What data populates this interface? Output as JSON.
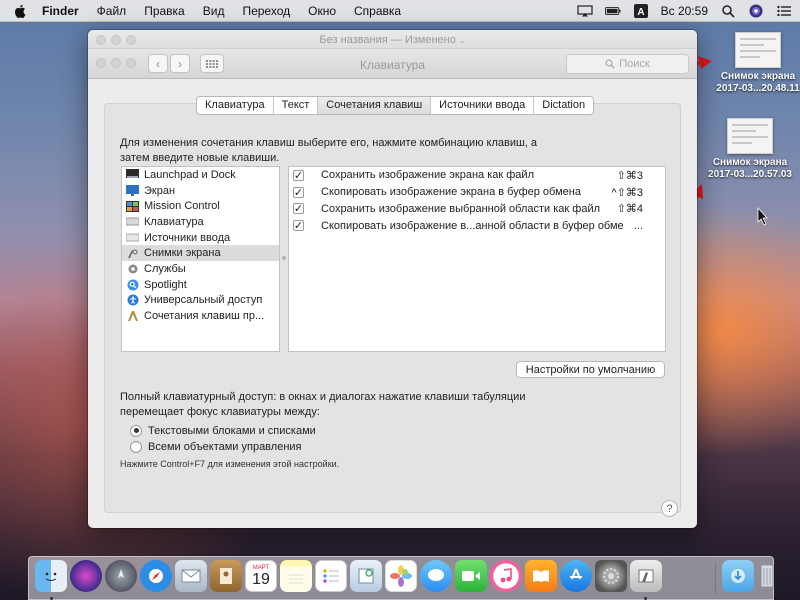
{
  "menubar": {
    "items": [
      {
        "label": "Finder",
        "bold": true
      },
      {
        "label": "Файл"
      },
      {
        "label": "Правка"
      },
      {
        "label": "Вид"
      },
      {
        "label": "Переход"
      },
      {
        "label": "Окно"
      },
      {
        "label": "Справка"
      }
    ],
    "input_source": "A",
    "clock": "Вс 20:59",
    "status_icons": [
      "airplay-icon",
      "battery-icon",
      "input-source-icon",
      "search-icon",
      "siri-icon",
      "notification-center-icon"
    ]
  },
  "window": {
    "document_title": "Без названия — Изменено",
    "pane_title": "Клавиатура",
    "search_placeholder": "Поиск",
    "tabs": [
      {
        "label": "Клавиатура",
        "active": false
      },
      {
        "label": "Текст",
        "active": false
      },
      {
        "label": "Сочетания клавиш",
        "active": true
      },
      {
        "label": "Источники ввода",
        "active": false
      },
      {
        "label": "Dictation",
        "active": false
      }
    ],
    "description": "Для изменения сочетания клавиш выберите его, нажмите комбинацию клавиш, а затем введите новые клавиши.",
    "categories": [
      {
        "label": "Launchpad и Dock",
        "icon": "launchpad-dock-icon",
        "selected": false
      },
      {
        "label": "Экран",
        "icon": "display-icon",
        "selected": false
      },
      {
        "label": "Mission Control",
        "icon": "mission-control-icon",
        "selected": false
      },
      {
        "label": "Клавиатура",
        "icon": "keyboard-icon",
        "selected": false
      },
      {
        "label": "Источники ввода",
        "icon": "input-sources-icon",
        "selected": false
      },
      {
        "label": "Снимки экрана",
        "icon": "screenshots-icon",
        "selected": true
      },
      {
        "label": "Службы",
        "icon": "services-gear-icon",
        "selected": false
      },
      {
        "label": "Spotlight",
        "icon": "spotlight-icon",
        "selected": false
      },
      {
        "label": "Универсальный доступ",
        "icon": "accessibility-icon",
        "selected": false
      },
      {
        "label": "Сочетания клавиш пр...",
        "icon": "app-shortcuts-icon",
        "selected": false
      }
    ],
    "shortcuts": [
      {
        "label": "Сохранить изображение экрана как файл",
        "keys": "⇧⌘3",
        "checked": true
      },
      {
        "label": "Скопировать изображение экрана в буфер обмена",
        "keys": "^⇧⌘3",
        "checked": true
      },
      {
        "label": "Сохранить изображение выбранной области как файл",
        "keys": "⇧⌘4",
        "checked": true
      },
      {
        "label": "Скопировать изображение в...анной области в буфер обмена",
        "keys": "...",
        "checked": true
      }
    ],
    "defaults_button": "Настройки по умолчанию",
    "full_keyboard_access": "Полный клавиатурный доступ: в окнах и диалогах нажатие клавиши табуляции перемещает фокус клавиатуры между:",
    "radio_options": [
      {
        "label": "Текстовыми блоками и списками",
        "selected": true
      },
      {
        "label": "Всеми объектами управления",
        "selected": false
      }
    ],
    "hint": "Нажмите Control+F7 для изменения этой настройки.",
    "help": "?"
  },
  "desktop": {
    "files": [
      {
        "line1": "Снимок экрана",
        "line2": "2017-03...20.48.11"
      },
      {
        "line1": "Снимок экрана",
        "line2": "2017-03...20.57.03"
      }
    ],
    "annotation_arrow_color": "#e0191e"
  },
  "calendar": {
    "month": "МАРТ",
    "day": "19"
  },
  "dock": {
    "apps": [
      "finder-icon",
      "siri-icon",
      "launchpad-icon",
      "safari-icon",
      "mail-icon",
      "contacts-icon",
      "calendar-icon",
      "notes-icon",
      "reminders-icon",
      "preview-icon",
      "photos-icon",
      "messages-icon",
      "facetime-icon",
      "itunes-icon",
      "ibooks-icon",
      "app-store-icon",
      "system-preferences-icon",
      "grab-icon"
    ],
    "right": [
      "downloads-folder-icon",
      "trash-icon"
    ]
  }
}
